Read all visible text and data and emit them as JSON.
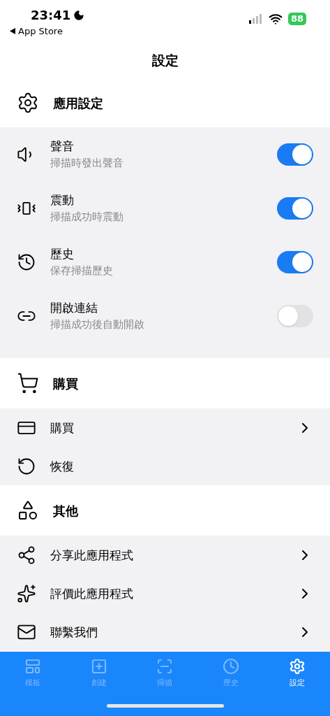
{
  "status_bar": {
    "time": "23:41",
    "back_label": "App Store",
    "battery": "88"
  },
  "title": "設定",
  "sections": [
    {
      "title": "應用設定",
      "rows": [
        {
          "kind": "toggle",
          "label": "聲音",
          "subtitle": "掃描時發出聲音",
          "on": true
        },
        {
          "kind": "toggle",
          "label": "震動",
          "subtitle": "掃描成功時震動",
          "on": true
        },
        {
          "kind": "toggle",
          "label": "歷史",
          "subtitle": "保存掃描歷史",
          "on": true
        },
        {
          "kind": "toggle",
          "label": "開啟連結",
          "subtitle": "掃描成功後自動開啟",
          "on": false
        }
      ]
    },
    {
      "title": "購買",
      "rows": [
        {
          "kind": "chevron",
          "label": "購買"
        },
        {
          "kind": "plain",
          "label": "恢復"
        }
      ]
    },
    {
      "title": "其他",
      "rows": [
        {
          "kind": "chevron",
          "label": "分享此應用程式"
        },
        {
          "kind": "chevron",
          "label": "評價此應用程式"
        },
        {
          "kind": "chevron",
          "label": "聯繫我們"
        }
      ]
    }
  ],
  "tabs": [
    {
      "label": "模板",
      "selected": false
    },
    {
      "label": "創建",
      "selected": false
    },
    {
      "label": "掃描",
      "selected": false
    },
    {
      "label": "歷史",
      "selected": false
    },
    {
      "label": "設定",
      "selected": true
    }
  ]
}
